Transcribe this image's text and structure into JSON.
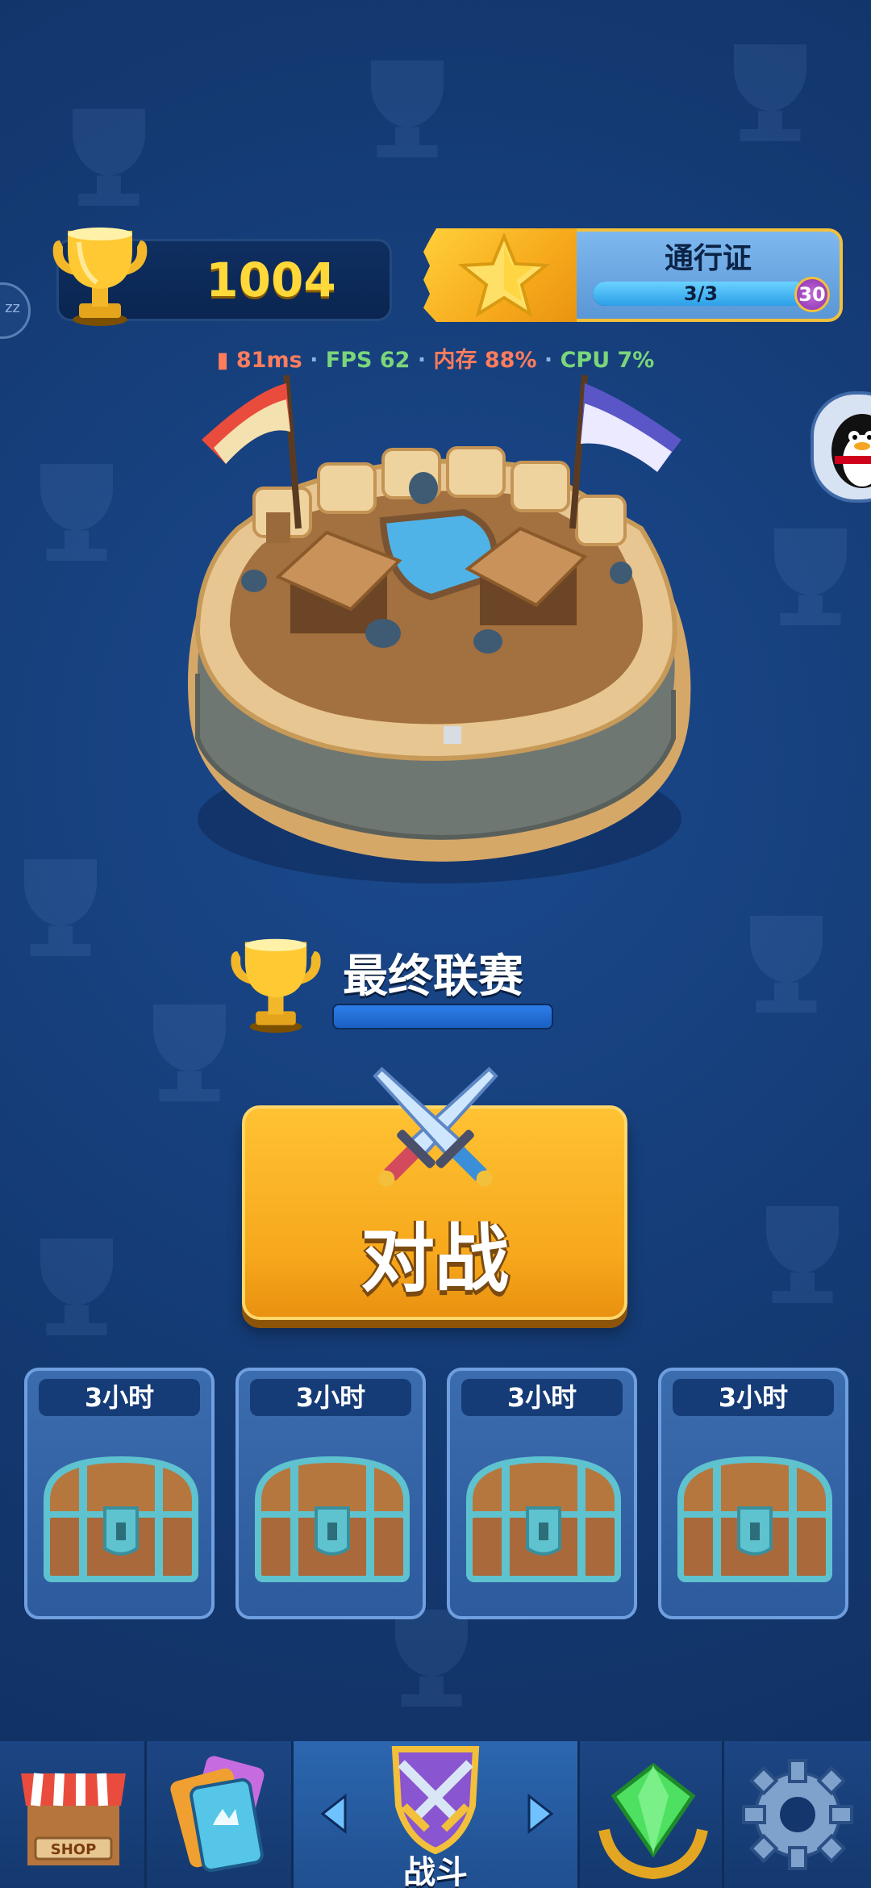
{
  "header": {
    "trophies": "1004",
    "pass": {
      "title": "通行证",
      "progress_text": "3/3",
      "progress": 1.0,
      "level": "30"
    },
    "left_badge": "zz"
  },
  "stats": {
    "ping": "81ms",
    "fps": "FPS 62",
    "memory": "内存 88%",
    "cpu": "CPU 7%",
    "separator": "·"
  },
  "league": {
    "name": "最终联赛",
    "progress": 1.0
  },
  "battle": {
    "label": "对战"
  },
  "chests": [
    {
      "time": "3小时"
    },
    {
      "time": "3小时"
    },
    {
      "time": "3小时"
    },
    {
      "time": "3小时"
    }
  ],
  "nav": {
    "shop_label": "SHOP",
    "battle_label": "战斗"
  },
  "colors": {
    "background": "#143a73",
    "trophy_text": "#ffd93a",
    "battle_button": "#f7a81c",
    "chest_slot": "#3b6cae"
  }
}
